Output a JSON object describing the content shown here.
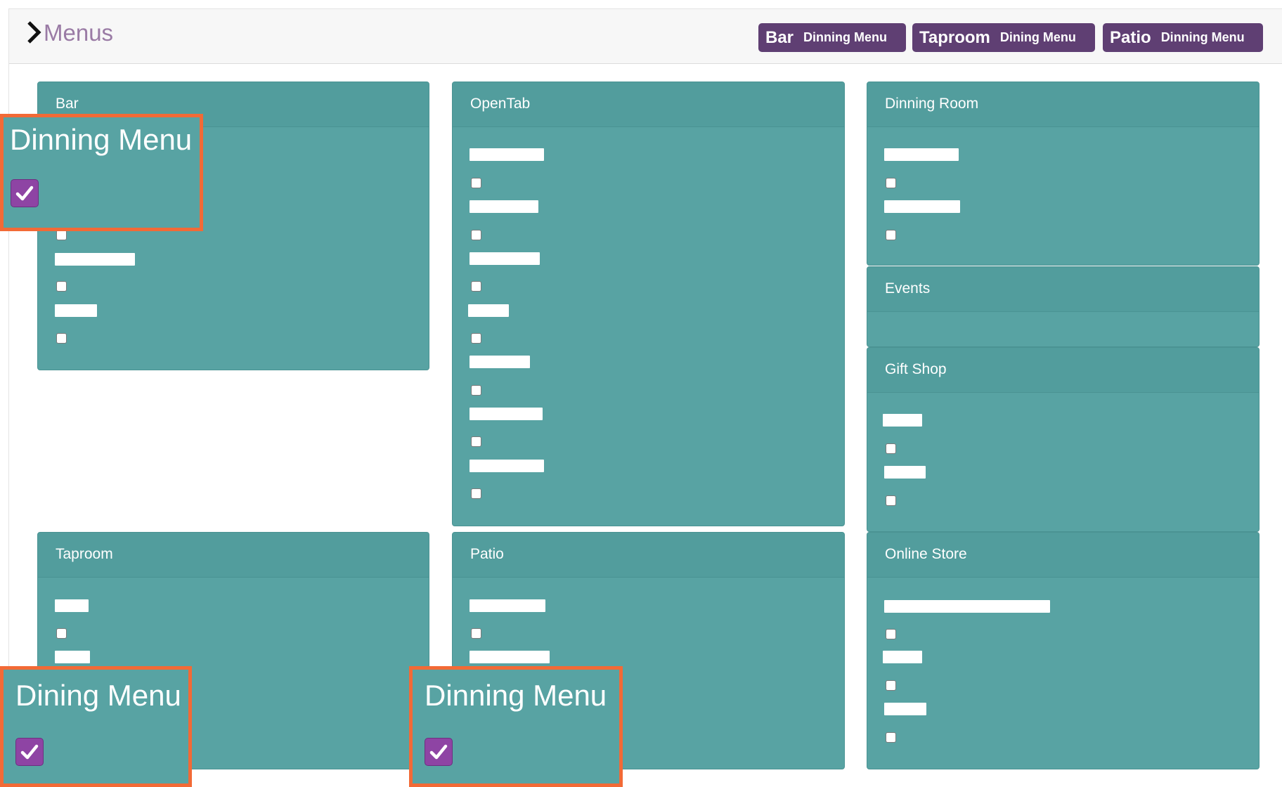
{
  "header": {
    "title": "Menus",
    "tags": [
      {
        "name": "Bar",
        "menu": "Dinning Menu"
      },
      {
        "name": "Taproom",
        "menu": "Dining Menu"
      },
      {
        "name": "Patio",
        "menu": "Dinning Menu"
      }
    ]
  },
  "panels": {
    "bar": "Bar",
    "opentab": "OpenTab",
    "dinning_room": "Dinning Room",
    "events": "Events",
    "gift_shop": "Gift Shop",
    "taproom": "Taproom",
    "patio": "Patio",
    "online_store": "Online Store"
  },
  "callouts": {
    "bar": {
      "label": "Dinning Menu",
      "checked": true
    },
    "taproom": {
      "label": "Dining Menu",
      "checked": true
    },
    "patio": {
      "label": "Dinning Menu",
      "checked": true
    }
  },
  "colors": {
    "panel": "#58a3a3",
    "tag": "#5f3f73",
    "callout_border": "#f26a36",
    "checkbox_checked": "#8e44a4",
    "title": "#9a7ba5"
  }
}
